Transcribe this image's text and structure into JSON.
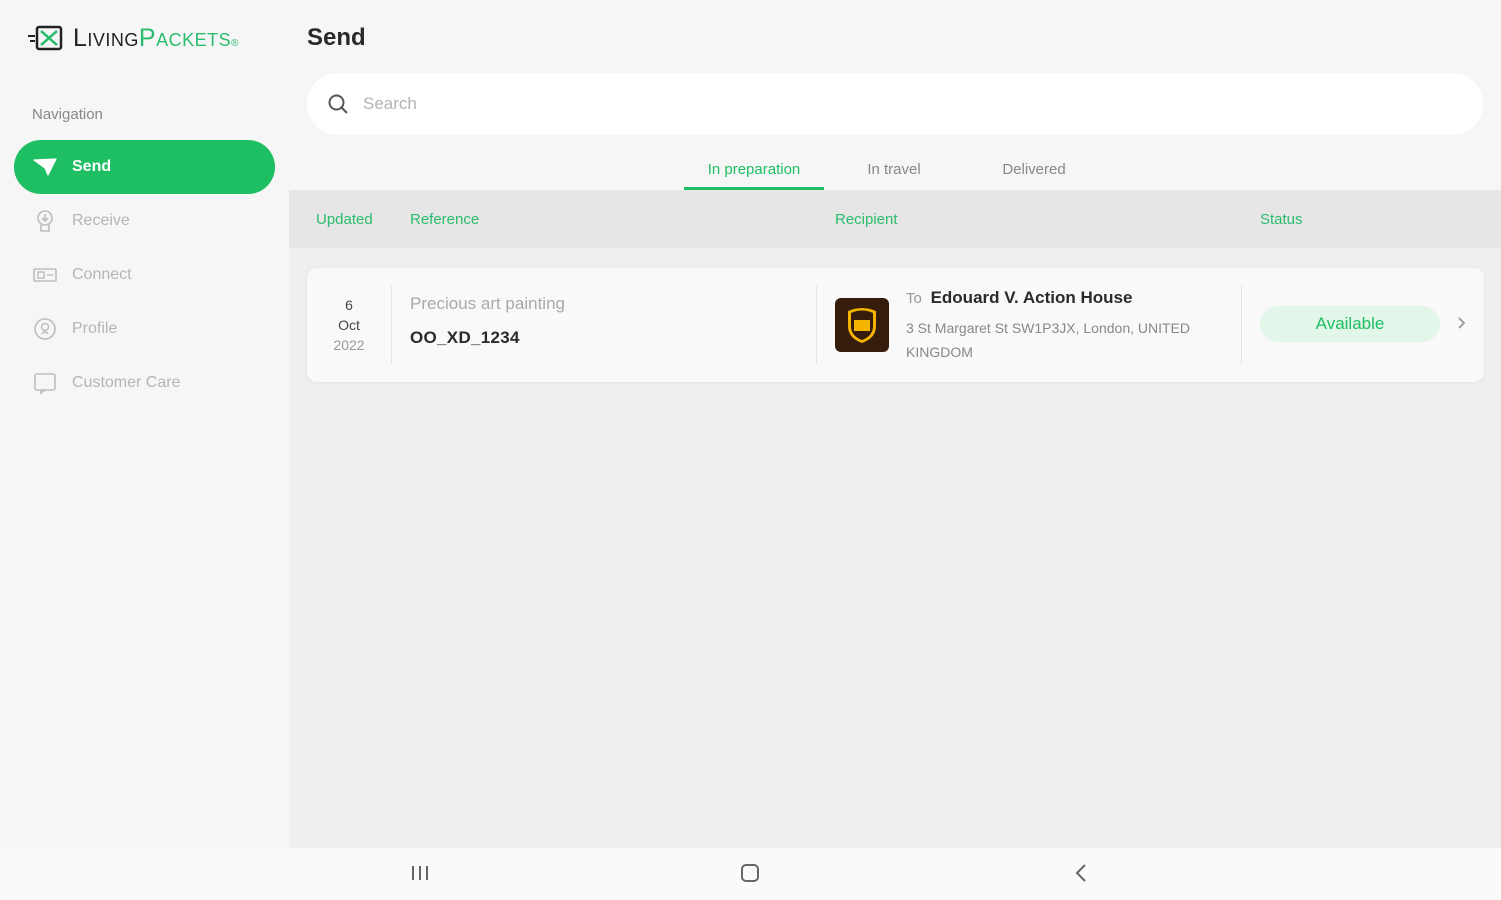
{
  "brand": {
    "name_part1": "Living",
    "name_part2": "Packets",
    "registered_mark": "®",
    "accent_color": "#1ebf63"
  },
  "sidebar": {
    "heading": "Navigation",
    "items": [
      {
        "label": "Send",
        "icon": "send-icon",
        "active": true
      },
      {
        "label": "Receive",
        "icon": "receive-icon",
        "active": false
      },
      {
        "label": "Connect",
        "icon": "connect-icon",
        "active": false
      },
      {
        "label": "Profile",
        "icon": "profile-icon",
        "active": false
      },
      {
        "label": "Customer Care",
        "icon": "customer-care-icon",
        "active": false
      }
    ]
  },
  "page": {
    "title": "Send"
  },
  "search": {
    "placeholder": "Search",
    "value": ""
  },
  "tabs": [
    {
      "label": "In preparation",
      "active": true
    },
    {
      "label": "In travel",
      "active": false
    },
    {
      "label": "Delivered",
      "active": false
    }
  ],
  "table": {
    "columns": {
      "updated": "Updated",
      "reference": "Reference",
      "recipient": "Recipient",
      "status": "Status"
    },
    "rows": [
      {
        "date": {
          "day": "6",
          "month": "Oct",
          "year": "2022"
        },
        "reference_name": "Precious art painting",
        "reference_code": "OO_XD_1234",
        "carrier_icon": "ups-logo-icon",
        "recipient_prefix": "To",
        "recipient_name": "Edouard V. Action House",
        "recipient_address": "3 St Margaret St SW1P3JX, London, UNITED KINGDOM",
        "status": "Available"
      }
    ]
  },
  "system_nav": {
    "buttons": [
      "recent-apps-icon",
      "home-icon",
      "back-icon"
    ]
  }
}
